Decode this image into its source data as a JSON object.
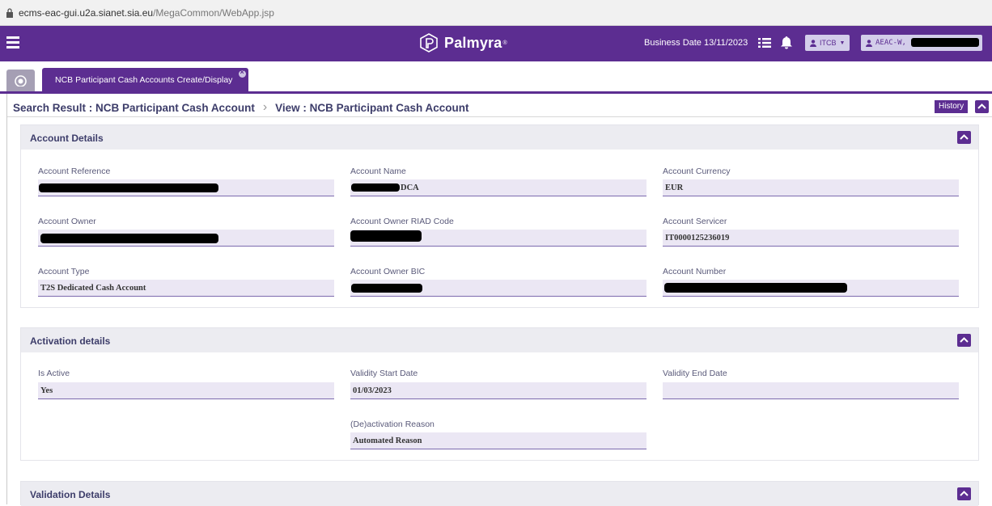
{
  "browser": {
    "url_host": "ecms-eac-gui.u2a.sianet.sia.eu",
    "url_path": "/MegaCommon/WebApp.jsp"
  },
  "header": {
    "brand": "Palmyra",
    "business_date": "Business Date 13/11/2023",
    "role": "ITCB",
    "user": "AEAC-W,",
    "accent_color": "#5c2d91"
  },
  "tabs": [
    {
      "label": "NCB Participant Cash Accounts Create/Display",
      "active": true
    }
  ],
  "breadcrumb": {
    "parent": "Search Result : NCB Participant Cash Account",
    "current": "View : NCB Participant Cash Account",
    "history_label": "History"
  },
  "sections": {
    "account_details": {
      "title": "Account Details",
      "fields": {
        "account_reference": {
          "label": "Account Reference",
          "value": ""
        },
        "account_name": {
          "label": "Account Name",
          "value": "DCA"
        },
        "account_currency": {
          "label": "Account Currency",
          "value": "EUR"
        },
        "account_owner": {
          "label": "Account Owner",
          "value": ""
        },
        "account_owner_riad": {
          "label": "Account Owner RIAD Code",
          "value": ""
        },
        "account_servicer": {
          "label": "Account Servicer",
          "value": "IT0000125236019"
        },
        "account_type": {
          "label": "Account Type",
          "value": "T2S Dedicated Cash Account"
        },
        "account_owner_bic": {
          "label": "Account Owner BIC",
          "value": ""
        },
        "account_number": {
          "label": "Account Number",
          "value": ""
        }
      }
    },
    "activation_details": {
      "title": "Activation details",
      "fields": {
        "is_active": {
          "label": "Is Active",
          "value": "Yes"
        },
        "validity_start": {
          "label": "Validity Start Date",
          "value": "01/03/2023"
        },
        "validity_end": {
          "label": "Validity End Date",
          "value": ""
        },
        "deactivation_reason": {
          "label": "(De)activation Reason",
          "value": "Automated Reason"
        }
      }
    },
    "validation_details": {
      "title": "Validation Details"
    }
  }
}
